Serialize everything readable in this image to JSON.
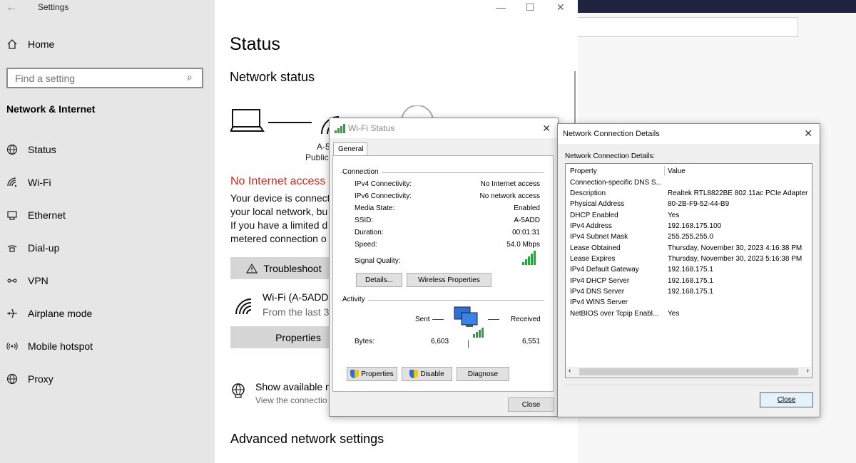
{
  "settings": {
    "app_title": "Settings",
    "home_label": "Home",
    "search_placeholder": "Find a setting",
    "section_title": "Network & Internet",
    "nav": [
      {
        "label": "Status",
        "icon": "globe-icon"
      },
      {
        "label": "Wi-Fi",
        "icon": "wifi-icon"
      },
      {
        "label": "Ethernet",
        "icon": "ethernet-icon"
      },
      {
        "label": "Dial-up",
        "icon": "dialup-icon"
      },
      {
        "label": "VPN",
        "icon": "vpn-icon"
      },
      {
        "label": "Airplane mode",
        "icon": "airplane-icon"
      },
      {
        "label": "Mobile hotspot",
        "icon": "hotspot-icon"
      },
      {
        "label": "Proxy",
        "icon": "proxy-globe-icon"
      }
    ]
  },
  "status_page": {
    "title": "Status",
    "subtitle": "Network status",
    "network_name_short": "A-5",
    "network_type_short": "Public",
    "no_internet": "No Internet access",
    "desc_lines": [
      "Your device is connect",
      "your local network, bu",
      "If you have a limited d",
      "metered connection o"
    ],
    "troubleshoot": "Troubleshoot",
    "wifi_name": "Wi-Fi (A-5ADD",
    "wifi_sub": "From the last 3",
    "properties": "Properties",
    "show_available": "Show available n",
    "show_sub": "View the connectio",
    "advanced_title": "Advanced network settings"
  },
  "wifi_status": {
    "title": "Wi-Fi Status",
    "tab": "General",
    "connection_label": "Connection",
    "rows": [
      {
        "k": "IPv4 Connectivity:",
        "v": "No Internet access"
      },
      {
        "k": "IPv6 Connectivity:",
        "v": "No network access"
      },
      {
        "k": "Media State:",
        "v": "Enabled"
      },
      {
        "k": "SSID:",
        "v": "A-5ADD"
      },
      {
        "k": "Duration:",
        "v": "00:01:31"
      },
      {
        "k": "Speed:",
        "v": "54.0 Mbps"
      }
    ],
    "signal_quality": "Signal Quality:",
    "details_btn": "Details...",
    "wireless_btn": "Wireless Properties",
    "activity_label": "Activity",
    "sent": "Sent",
    "received": "Received",
    "bytes_label": "Bytes:",
    "bytes_sent": "6,603",
    "bytes_received": "6,551",
    "properties_btn": "Properties",
    "disable_btn": "Disable",
    "diagnose_btn": "Diagnose",
    "close_btn": "Close"
  },
  "ncd": {
    "title": "Network Connection Details",
    "subtitle": "Network Connection Details:",
    "col_property": "Property",
    "col_value": "Value",
    "rows": [
      {
        "p": "Connection-specific DNS S...",
        "v": ""
      },
      {
        "p": "Description",
        "v": "Realtek RTL8822BE 802.11ac PCIe Adapter"
      },
      {
        "p": "Physical Address",
        "v": "80-2B-F9-52-44-B9"
      },
      {
        "p": "DHCP Enabled",
        "v": "Yes"
      },
      {
        "p": "IPv4 Address",
        "v": "192.168.175.100"
      },
      {
        "p": "IPv4 Subnet Mask",
        "v": "255.255.255.0"
      },
      {
        "p": "Lease Obtained",
        "v": "Thursday, November 30, 2023 4:16:38 PM"
      },
      {
        "p": "Lease Expires",
        "v": "Thursday, November 30, 2023 5:16:38 PM"
      },
      {
        "p": "IPv4 Default Gateway",
        "v": "192.168.175.1"
      },
      {
        "p": "IPv4 DHCP Server",
        "v": "192.168.175.1"
      },
      {
        "p": "IPv4 DNS Server",
        "v": "192.168.175.1"
      },
      {
        "p": "IPv4 WINS Server",
        "v": ""
      },
      {
        "p": "NetBIOS over Tcpip Enabl...",
        "v": "Yes"
      }
    ],
    "close_btn": "Close"
  },
  "colors": {
    "error_red": "#c42b1c",
    "accent_blue": "#0078d7",
    "signal_green": "#2ea043"
  }
}
